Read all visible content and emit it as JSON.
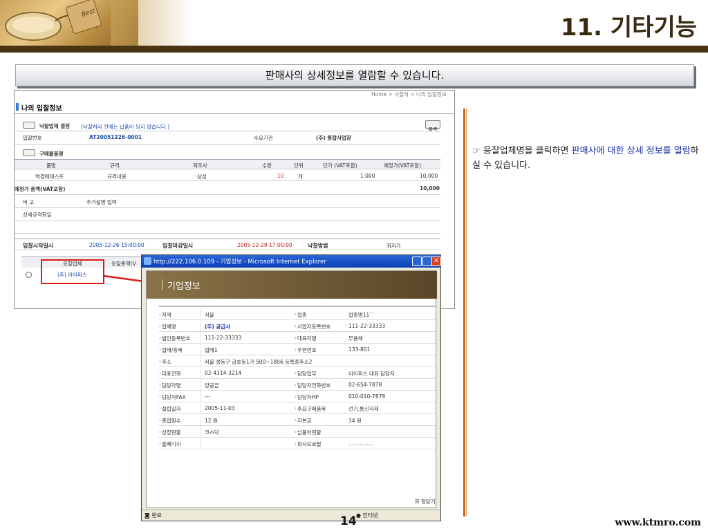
{
  "header": {
    "title": "11. 기타기능",
    "logo_text": "Best"
  },
  "caption": "판매사의 상세정보를 열람할 수 있습니다.",
  "frame": {
    "breadcrumb": "Home > 낙찰허 > 나의 입찰정보",
    "section_title": "나의 입찰정보",
    "list_button": "목록",
    "winner_label": "낙찰업체 결정",
    "winner_note": "(낙찰처리 전에는 납품이 되지 않습니다.)",
    "bid_no_label": "입찰번호",
    "bid_no_value": "AT20051226-0001",
    "agency_label": "수요기관",
    "agency_value": "(주) 통합사업장",
    "items_label": "구매물품명",
    "item_headers": [
      "품명",
      "규격",
      "제조사",
      "수량",
      "단위",
      "단가 (VAT포함)",
      "예정가(VAT포함)"
    ],
    "item_row": [
      "역경매테스트",
      "규격내용",
      "삼성",
      "10",
      "개",
      "1,000",
      "10,000"
    ],
    "total_label": "예정가 총액(VAT포함)",
    "total_value": "10,000",
    "remark_label": "비 고",
    "remark_value": "추가설명 입력",
    "spec_label": "상세규격화일",
    "start_label": "입찰시작일시",
    "start_value": "2005-12-26 15:00:00",
    "end_label": "입찰마감일시",
    "end_value": "2005-12-28 17:00:00",
    "method_label": "낙찰방법",
    "method_value": "최저가",
    "bidder_header": "응찰업체",
    "amount_header": "응찰총액(V",
    "bidder_name": "(주) 아이피스"
  },
  "popup": {
    "title": "http://222.106.0.109 - 기업정보 - Microsoft Internet Explorer",
    "heading": "기업정보",
    "rows": [
      [
        "지역",
        "서울",
        "업종",
        "업종명11``"
      ],
      [
        "업체명",
        "(주) 공급사",
        "사업자등록번호",
        "111-22-33333"
      ],
      [
        "법인등록번호",
        "111-22-33333",
        "대표자명",
        "무용해"
      ],
      [
        "업태/종목",
        "업태1",
        "우편번호",
        "133-801"
      ],
      [
        "주소",
        "서울 성동구 금호동1가 500~1806 등록중주소2",
        "",
        ""
      ],
      [
        "대표전화",
        "02-4314-3214",
        "담당업무",
        "아이피스 대표 담당자."
      ],
      [
        "담당자명",
        "양공급",
        "담당자전화번호",
        "02-654-7878"
      ],
      [
        "담당자FAX",
        "---",
        "담당자HP",
        "010-010-7878"
      ],
      [
        "설립일자",
        "2005-11-03",
        "주요구매품목",
        "전기,통신자재"
      ],
      [
        "종업원수",
        "12 원",
        "자본금",
        "34 원"
      ],
      [
        "상장현황",
        "코스닥",
        "납품처현황",
        ""
      ],
      [
        "홈페이지",
        "",
        "회사프로필",
        "..............."
      ]
    ],
    "close_label": "창닫기",
    "status_left": "완료",
    "status_right": "인터넷"
  },
  "note": {
    "prefix": "☞ 응찰업체명을 클릭하면 ",
    "highlight1": "판매사에 대한 상세 정보를 열람",
    "suffix": "하실 수 있습니다."
  },
  "footer": {
    "page": "14",
    "url": "www.ktmro.com"
  }
}
